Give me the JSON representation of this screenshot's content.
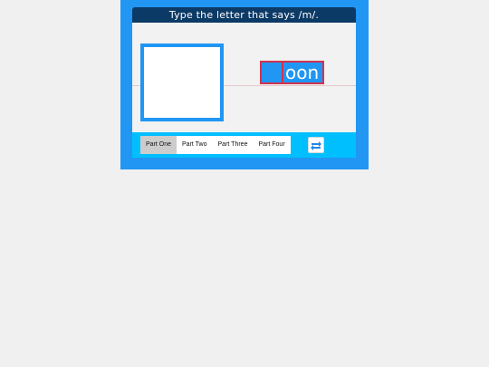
{
  "prompt": "Type the letter that says /m/.",
  "picture": {
    "icon": "crescent-moon",
    "moon_color": "#ffff00",
    "frame_color": "#2196f3"
  },
  "word": {
    "typed_letter": "",
    "rest": "oon",
    "box_color": "#2196f3",
    "border_color": "#d2334f"
  },
  "tabs": [
    {
      "label": "Part One",
      "active": true
    },
    {
      "label": "Part Two",
      "active": false
    },
    {
      "label": "Part Three",
      "active": false
    },
    {
      "label": "Part Four",
      "active": false
    }
  ],
  "refresh_icon": "swap-arrows-icon",
  "colors": {
    "app_bg": "#2196f3",
    "title_bg": "#0c3a66",
    "bottom_bar": "#00bfff"
  }
}
